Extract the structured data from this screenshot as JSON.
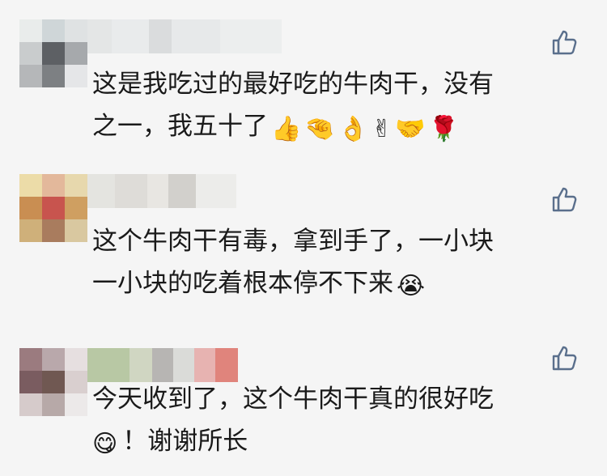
{
  "comments": [
    {
      "lines": [
        "这是我吃过的最好吃的牛肉干，没有",
        "之一，我五十了"
      ],
      "emojis": [
        "👍",
        "🤏",
        "👌",
        "✌",
        "🤝",
        "🌹"
      ],
      "avatar_colors": [
        "#e9eceb",
        "#cfd6d8",
        "#dfe2e3",
        "#c9cccd",
        "#5d6064",
        "#a6a9ac",
        "#b5b7b9",
        "#7d8083",
        "#e5e6e8"
      ],
      "name_colors": [
        "#e4e6e6",
        "#e9ebec",
        "#dadcdd",
        "#e7e9ea",
        "#eceeee"
      ],
      "like_icon": "thumbs-up-outline-icon"
    },
    {
      "lines": [
        "这个牛肉干有毒，拿到手了，一小块",
        "一小块的吃着根本停不下来"
      ],
      "emojis": [
        "😭"
      ],
      "avatar_colors": [
        "#ecdca8",
        "#e3b89b",
        "#e7d8ad",
        "#c98e52",
        "#c8544e",
        "#cf9f61",
        "#cfb07a",
        "#a97c5e",
        "#d9c8a0"
      ],
      "name_colors": [
        "#e4e4e0",
        "#dedcd8",
        "#e8e6e2",
        "#d2d0cc",
        "#ececea"
      ],
      "like_icon": "thumbs-up-outline-icon"
    },
    {
      "lines": [
        "今天收到了，这个牛肉干真的很好吃",
        "！谢谢所长"
      ],
      "emojis": [
        "😋"
      ],
      "avatar_colors": [
        "#9b7b7f",
        "#b9a8ab",
        "#e6dfe0",
        "#7a5c60",
        "#705852",
        "#d9cfcf",
        "#d6cbcb",
        "#b7a9a8",
        "#ece9e9"
      ],
      "name_colors": [
        "#b8c8a4",
        "#d0d6c2",
        "#b7b5b3",
        "#dadbd8",
        "#e7b3b1",
        "#e0847c"
      ],
      "like_icon": "thumbs-up-outline-icon"
    }
  ]
}
